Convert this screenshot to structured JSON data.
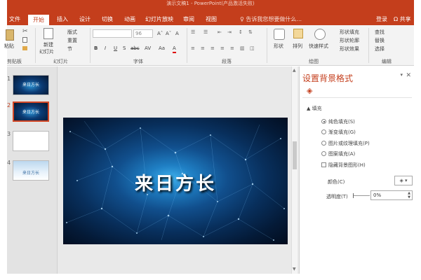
{
  "window": {
    "title": "演示文稿1 - PowerPoint(产品激活失败)"
  },
  "tabs": [
    {
      "label": "文件",
      "active": false
    },
    {
      "label": "开始",
      "active": true
    },
    {
      "label": "插入",
      "active": false
    },
    {
      "label": "设计",
      "active": false
    },
    {
      "label": "切换",
      "active": false
    },
    {
      "label": "动画",
      "active": false
    },
    {
      "label": "幻灯片放映",
      "active": false
    },
    {
      "label": "审阅",
      "active": false
    },
    {
      "label": "视图",
      "active": false
    }
  ],
  "tellme": "♀ 告诉我您想要做什么...",
  "account": {
    "login": "登录",
    "share": "Ω 共享"
  },
  "ribbon": {
    "clipboard": {
      "paste": "粘贴",
      "label": "剪贴板"
    },
    "slides": {
      "new_slide": "新建",
      "new_slide2": "幻灯片",
      "layout": "版式",
      "reset": "重置",
      "section": "节",
      "label": "幻灯片"
    },
    "font": {
      "size": "96",
      "bold": "B",
      "italic": "I",
      "underline": "U",
      "strike": "S",
      "shadow": "abc",
      "spacing": "AV",
      "case": "Aa",
      "color": "A",
      "grow": "Aˆ",
      "shrink": "Aˇ",
      "clear": "A",
      "label": "字体"
    },
    "paragraph": {
      "label": "段落"
    },
    "drawing": {
      "shapes": "形状",
      "arrange": "排列",
      "quick_styles": "快速样式",
      "fill": "形状填充",
      "outline": "形状轮廓",
      "effect": "形状效果",
      "label": "绘图"
    },
    "editing": {
      "find": "查找",
      "replace": "替换",
      "select": "选择",
      "label": "编辑"
    }
  },
  "thumbnails": [
    {
      "number": "1",
      "style": "dark",
      "text": "来日方长",
      "selected": false
    },
    {
      "number": "2",
      "style": "dark",
      "text": "来日方长",
      "selected": true
    },
    {
      "number": "3",
      "style": "white",
      "text": "",
      "selected": false
    },
    {
      "number": "4",
      "style": "sky",
      "text": "来日方长",
      "selected": false
    }
  ],
  "slide": {
    "title": "来日方长"
  },
  "format_pane": {
    "title": "设置背景格式",
    "section": "▲ 填充",
    "options": [
      {
        "label": "纯色填充(S)",
        "selected": true
      },
      {
        "label": "渐变填充(G)",
        "selected": false
      },
      {
        "label": "图片或纹理填充(P)",
        "selected": false
      },
      {
        "label": "图案填充(A)",
        "selected": false
      }
    ],
    "hide_bg": "隐藏背景图形(H)",
    "color_label": "颜色(C)",
    "transparency_label": "透明度(T)",
    "transparency_value": "0%"
  },
  "colors": {
    "accent": "#c43e1c",
    "selection": "#d24726"
  }
}
